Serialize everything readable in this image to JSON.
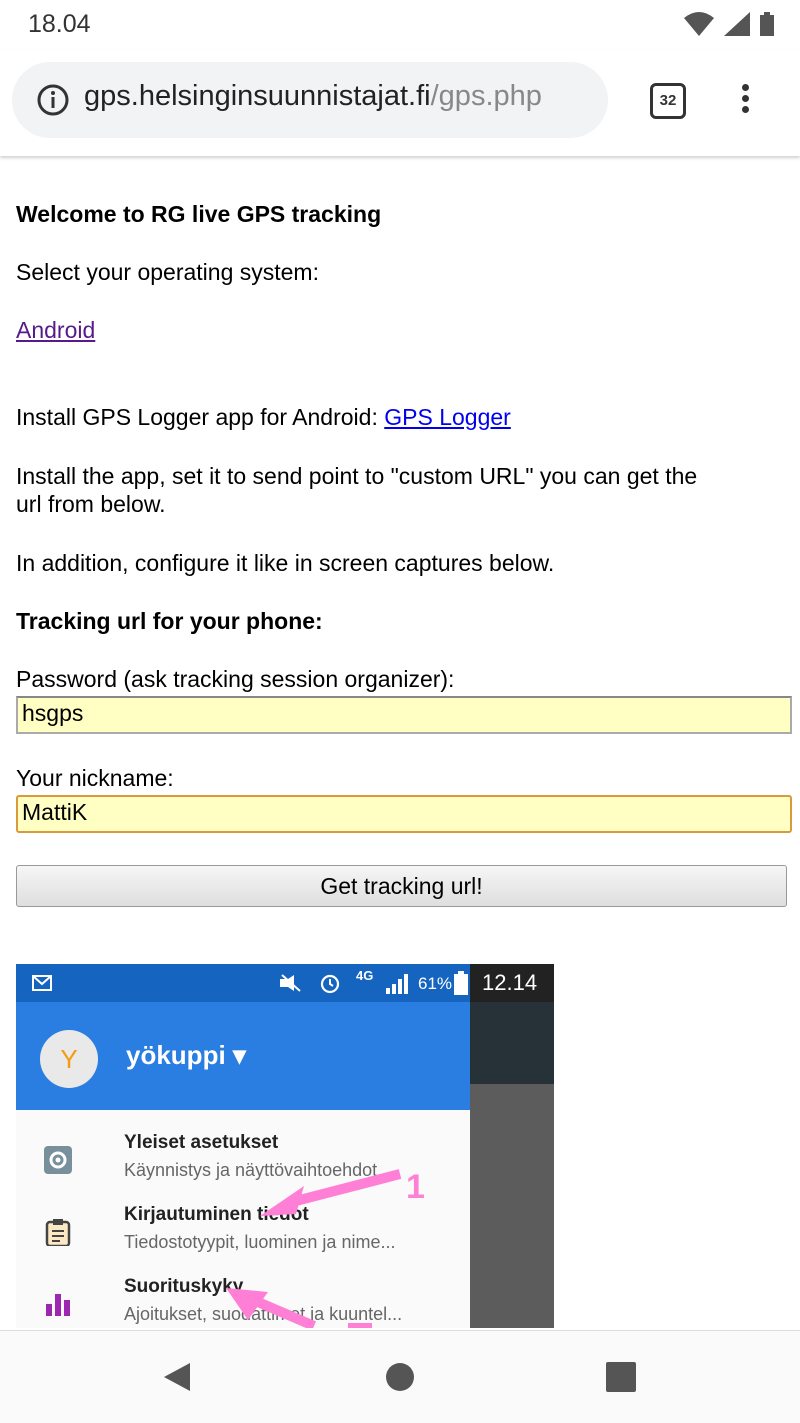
{
  "status_bar": {
    "time": "18.04"
  },
  "browser": {
    "url_host": "gps.helsinginsuunnistajat.fi",
    "url_path": "/gps.php",
    "tab_count": "32"
  },
  "page": {
    "welcome": "Welcome to RG live GPS tracking",
    "select_os": "Select your operating system:",
    "android_link": "Android",
    "install_text": "Install GPS Logger app for Android: ",
    "gps_logger_link": "GPS Logger",
    "install_line1": "Install the app, set it to send point to \"custom URL\" you can get the",
    "install_line2": "url from below.",
    "configure": "In addition, configure it like in screen captures below.",
    "tracking_heading": "Tracking url for your phone:",
    "password_label": "Password (ask tracking session organizer):",
    "password_value": "hsgps",
    "nickname_label": "Your nickname:",
    "nickname_value": "MattiK",
    "get_url_button": "Get tracking url!"
  },
  "screenshot": {
    "status_percent": "61%",
    "status_net": "4G",
    "time": "12.14",
    "avatar_letter": "Y",
    "account_name": "yökuppi",
    "items": [
      {
        "title": "Yleiset asetukset",
        "subtitle": "Käynnistys ja näyttövaihtoehdot",
        "icon": "gear-icon"
      },
      {
        "title": "Kirjautuminen tiedot",
        "subtitle": "Tiedostotyypit, luominen ja nime...",
        "icon": "clipboard-icon"
      },
      {
        "title": "Suorituskyky",
        "subtitle": "Ajoitukset, suodattimet ja kuuntel...",
        "icon": "bar-chart-icon"
      }
    ],
    "annotation_1": "1"
  },
  "icons": {
    "wifi": "wifi-icon",
    "signal": "signal-icon",
    "battery": "battery-icon",
    "info": "info-icon",
    "back": "back-icon",
    "home": "home-icon",
    "recents": "recents-icon"
  },
  "colors": {
    "input_bg": "#ffffc3",
    "link": "#0000ee",
    "visited": "#551a8b",
    "app_blue": "#2a7de1"
  }
}
